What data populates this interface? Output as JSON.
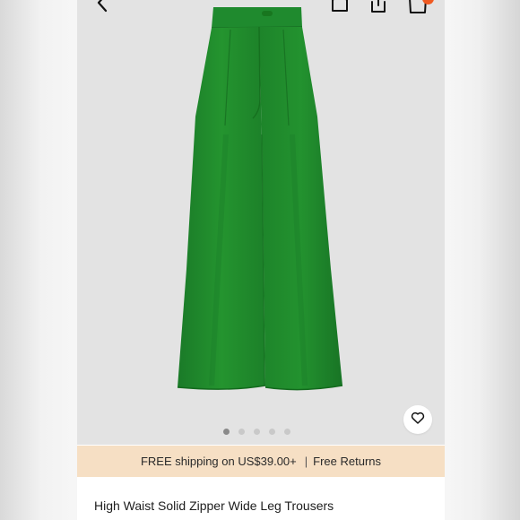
{
  "product": {
    "title": "High Waist Solid Zipper Wide Leg Trousers",
    "image_icon": "green-wide-leg-trousers",
    "color": "#1f8a2e"
  },
  "gallery": {
    "page_count": 5,
    "active_index": 0
  },
  "shipping_bar": {
    "free_shipping": "FREE shipping on US$39.00+",
    "separator": "|",
    "free_returns": "Free Returns"
  },
  "icons": {
    "back": "chevron-left-icon",
    "home": "home-icon",
    "share": "share-icon",
    "cart": "shopping-bag-icon",
    "wishlist": "heart-icon"
  },
  "colors": {
    "accent_badge": "#f05a22",
    "shipping_bg": "#f6dfc4",
    "hero_bg": "#e3e3e3"
  }
}
